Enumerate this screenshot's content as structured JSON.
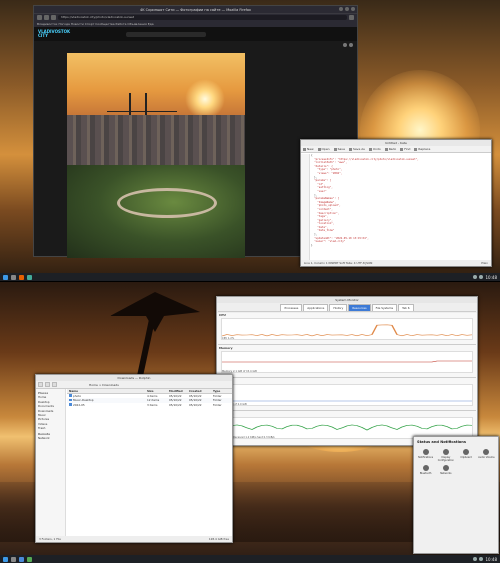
{
  "top_screen": {
    "browser": {
      "title": "4K Скриншот Сити — Фотографии на сайте — Mozilla Firefox",
      "url": "https://vladivostok.city/photo/vladivostok-sunset",
      "bookmarks": "Владивосток  Погода  Новости  Спорт  Сообщества  Работа  Объявления  Еда",
      "site_logo_line1": "VLADIVOSTOK",
      "site_logo_line2": "CITY"
    },
    "editor": {
      "title": "Untitled - Kate",
      "tools": [
        "New",
        "Open",
        "Save",
        "Save As",
        "Undo",
        "Redo",
        "Find",
        "Replace"
      ],
      "lines": [
        "{",
        "  \"processInfo\": \"https://vladivostok.city/photo/vladivostok-sunset\",",
        "  \"initialPath\": \"www\",",
        "  \"details\": {",
        "    \"type\": \"photo\",",
        "    \"views\": \"2894\",",
        "  },",
        "  \"params\": [",
        "    \"id\",",
        "    \"setting\",",
        "    \"user\"",
        "  ],",
        "  \"paramsNames\": [",
        "    \"ImageName\",",
        "    \"photo_upload\",",
        "    \"content\",",
        "    \"description\",",
        "    \"tags\",",
        "    \"gallery\",",
        "    \"location\",",
        "    \"date\",",
        "    \"date_time\"",
        "  ],",
        "  \"updatedAt\": \"2022-05-10 13:15:04\",",
        "  \"owner\": \"vlad.city\"",
        "}"
      ],
      "status_left": "Line 1, Column 1   INSERT   Soft Tabs: 4   UTF-8   JSON",
      "status_right": "Plain"
    },
    "clock": "10:48"
  },
  "bottom_screen": {
    "sysmon": {
      "title": "System Monitor",
      "tabs": [
        "Processes",
        "Applications",
        "History",
        "Resources",
        "File Systems",
        "Tab 6"
      ],
      "active_tab": 3,
      "sections": [
        {
          "label": "CPU",
          "caption": "CPU  1.2%",
          "color": "#e08a4a"
        },
        {
          "label": "Memory",
          "caption": "Memory  2.1 GiB of 15.4 GiB",
          "color": "#c0392b"
        },
        {
          "label": "Swap",
          "caption": "Swap  0 B of 2.0 GiB",
          "color": "#6b8fd6"
        },
        {
          "label": "Network",
          "caption": "Network  Received 1.2 KiB/s  Sent 0.3 KiB/s",
          "color": "#2ea043"
        }
      ]
    },
    "dolphin": {
      "title": "Downloads — Dolphin",
      "breadcrumb": "Home  >  Downloads",
      "places_header": "Places",
      "places": [
        "Home",
        "Desktop",
        "Documents",
        "Downloads",
        "Music",
        "Pictures",
        "Videos",
        "Trash"
      ],
      "remote_header": "Remote",
      "remote": [
        "Network"
      ],
      "columns": [
        "Name",
        "Size",
        "Modified",
        "Created",
        "Type"
      ],
      "rows": [
        {
          "name": "photo",
          "size": "4 items",
          "modified": "05/10/22",
          "created": "05/10/22",
          "type": "Folder"
        },
        {
          "name": "Music-Desktop",
          "size": "12 items",
          "modified": "05/10/22",
          "created": "05/10/22",
          "type": "Folder"
        },
        {
          "name": "2022-05",
          "size": "3 items",
          "modified": "05/10/22",
          "created": "05/10/22",
          "type": "Folder"
        }
      ],
      "status_left": "3 Folders, 1 File",
      "status_right": "128.4 GiB free"
    },
    "notifications": {
      "title": "Status and Notifications",
      "items": [
        "Notifications",
        "Display Configuration",
        "Clipboard",
        "Audio Volume",
        "Bluetooth",
        "Networks"
      ]
    },
    "clock": "10:48"
  }
}
